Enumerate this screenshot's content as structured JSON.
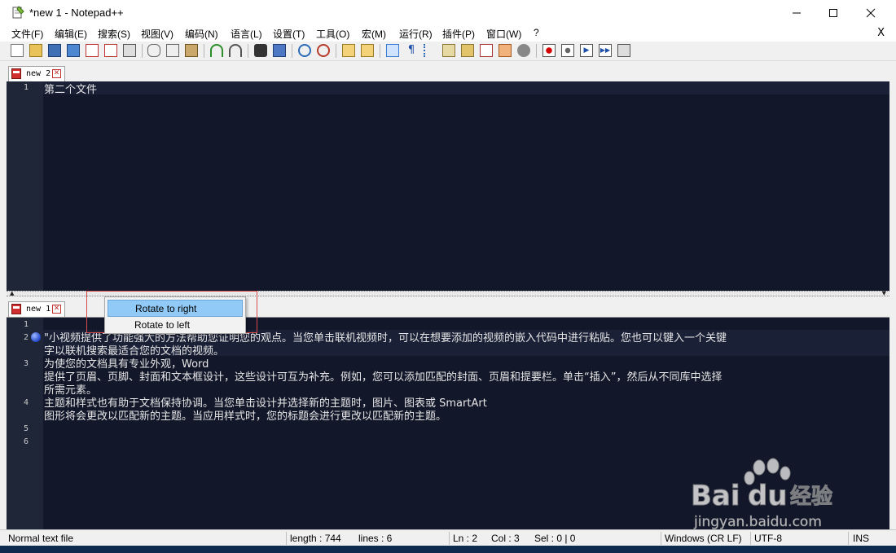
{
  "window": {
    "title": "*new 1 - Notepad++"
  },
  "menu": [
    {
      "label": "文件(F)"
    },
    {
      "label": "编辑(E)"
    },
    {
      "label": "搜索(S)"
    },
    {
      "label": "视图(V)"
    },
    {
      "label": "编码(N)"
    },
    {
      "label": "语言(L)"
    },
    {
      "label": "设置(T)"
    },
    {
      "label": "工具(O)"
    },
    {
      "label": "宏(M)"
    },
    {
      "label": "运行(R)"
    },
    {
      "label": "插件(P)"
    },
    {
      "label": "窗口(W)"
    },
    {
      "label": "?"
    }
  ],
  "menu_close": "X",
  "toolbar_icons": [
    "new-file-icon",
    "open-file-icon",
    "save-icon",
    "save-all-icon",
    "close-icon",
    "close-all-icon",
    "print-icon",
    "cut-icon",
    "copy-icon",
    "paste-icon",
    "undo-icon",
    "redo-icon",
    "find-icon",
    "replace-icon",
    "zoom-in-icon",
    "zoom-out-icon",
    "sync-vertical-icon",
    "sync-horizontal-icon",
    "word-wrap-icon",
    "show-all-chars-icon",
    "indent-guide-icon",
    "function-list-icon",
    "folder-workspace-icon",
    "doc-map-icon",
    "doc-list-icon",
    "monitoring-icon",
    "record-macro-icon",
    "stop-macro-icon",
    "play-macro-icon",
    "run-macro-icon",
    "save-macro-icon"
  ],
  "top_pane": {
    "tab": {
      "label": "new 2"
    },
    "lines": [
      {
        "num": "1",
        "text": "第二个文件"
      }
    ]
  },
  "bottom_pane": {
    "tab": {
      "label": "new 1"
    },
    "lines": [
      {
        "num": "1",
        "rows": [
          ""
        ]
      },
      {
        "num": "2",
        "rows": [
          "\"小视频提供了功能强大的方法帮助您证明您的观点。当您单击联机视频时，可以在想要添加的视频的嵌入代码中进行粘贴。您也可以键入一个关键",
          "字以联机搜索最适合您的文档的视频。"
        ]
      },
      {
        "num": "3",
        "rows": [
          "为使您的文档具有专业外观，Word",
          "提供了页眉、页脚、封面和文本框设计，这些设计可互为补充。例如，您可以添加匹配的封面、页眉和提要栏。单击“插入”，然后从不同库中选择",
          "所需元素。"
        ]
      },
      {
        "num": "4",
        "rows": [
          "主题和样式也有助于文档保持协调。当您单击设计并选择新的主题时，图片、图表或 SmartArt",
          "图形将会更改以匹配新的主题。当应用样式时，您的标题会进行更改以匹配新的主题。"
        ]
      },
      {
        "num": "5",
        "rows": [
          ""
        ]
      },
      {
        "num": "6",
        "rows": [
          ""
        ]
      }
    ]
  },
  "context_menu": {
    "items": [
      {
        "label": "Rotate to right"
      },
      {
        "label": "Rotate to left"
      }
    ]
  },
  "status": {
    "filetype": "Normal text file",
    "length": "length : 744",
    "lines": "lines : 6",
    "ln": "Ln : 2",
    "col": "Col : 3",
    "sel": "Sel : 0 | 0",
    "eol": "Windows (CR LF)",
    "encoding": "UTF-8",
    "mode": "INS"
  },
  "watermark": {
    "brand": "Baidu",
    "cn": "经验",
    "url": "jingyan.baidu.com"
  },
  "colors": {
    "editor_bg": "#12172a",
    "gutter_bg": "#1f2638",
    "text": "#e6e6e6",
    "menu_highlight": "#91c9f7"
  }
}
